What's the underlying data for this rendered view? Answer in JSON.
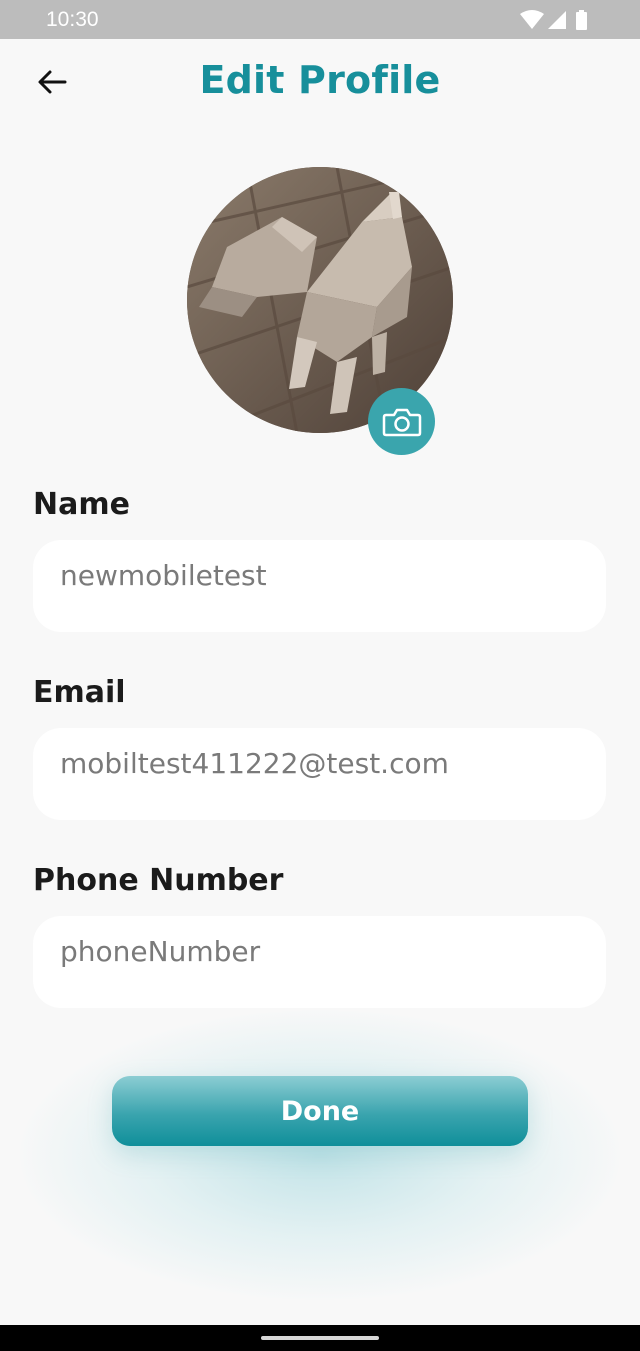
{
  "status_bar": {
    "time": "10:30"
  },
  "header": {
    "title": "Edit Profile",
    "back_icon": "arrow-left-icon"
  },
  "avatar": {
    "camera_icon": "camera-icon"
  },
  "form": {
    "name": {
      "label": "Name",
      "value": "newmobiletest"
    },
    "email": {
      "label": "Email",
      "value": "mobiltest411222@test.com"
    },
    "phone": {
      "label": "Phone Number",
      "value": "phoneNumber"
    }
  },
  "actions": {
    "done_label": "Done"
  },
  "colors": {
    "accent": "#178f9b",
    "button_light": "#8ccdd3",
    "button_dark": "#0f8f9a",
    "background": "#f8f8f8"
  }
}
